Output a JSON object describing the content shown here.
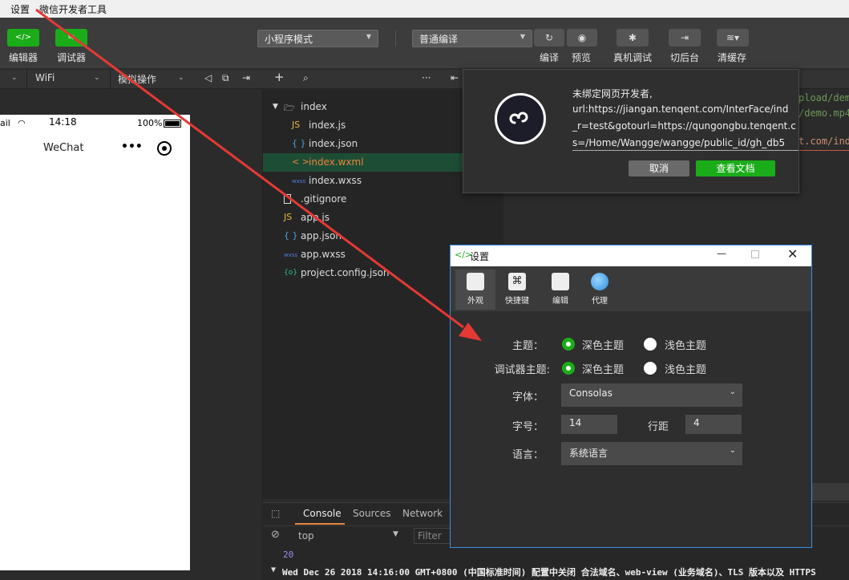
{
  "menubar": {
    "settings": "设置",
    "app_name": "微信开发者工具"
  },
  "toolbar": {
    "editor_label": "编辑器",
    "debugger_label": "调试器",
    "mode_select": "小程序模式",
    "compile_select": "普通编译",
    "compile_label": "编译",
    "preview_label": "预览",
    "device_debug_label": "真机调试",
    "background_label": "切后台",
    "clear_cache_label": "清缓存"
  },
  "subbar": {
    "network": "WiFi",
    "sim_ops": "模拟操作"
  },
  "phone": {
    "carrier": "ail",
    "time": "14:18",
    "battery": "100%",
    "title": "WeChat"
  },
  "filetree": {
    "folder": "index",
    "files": [
      {
        "name": "index.js",
        "icon": "JS",
        "color": "#e8b840"
      },
      {
        "name": "index.json",
        "icon": "{ }",
        "color": "#4aa3df"
      },
      {
        "name": "index.wxml",
        "icon": "< >",
        "color": "#e8843c"
      },
      {
        "name": "index.wxss",
        "icon": "wxss",
        "color": "#4a7fdf"
      },
      {
        "name": ".gitignore",
        "icon": "doc",
        "color": "#ddd"
      },
      {
        "name": "app.js",
        "icon": "JS",
        "color": "#e8b840"
      },
      {
        "name": "app.json",
        "icon": "{ }",
        "color": "#4aa3df"
      },
      {
        "name": "app.wxss",
        "icon": "wxss",
        "color": "#4a7fdf"
      },
      {
        "name": "project.config.json",
        "icon": "{o}",
        "color": "#2bbf8f"
      }
    ]
  },
  "editor": {
    "line1": "pload/dem",
    "line2": "/demo.mp4",
    "line3": "t.com/ind"
  },
  "notification": {
    "line1": "未绑定网页开发者,",
    "line2": "url:https://jiangan.tenqent.com/InterFace/ind",
    "line3": "_r=test&gotourl=https://qungongbu.tenqent.c",
    "line4": "s=/Home/Wangge/wangge/public_id/gh_db5",
    "cancel": "取消",
    "docs": "查看文档"
  },
  "settings": {
    "title": "设置",
    "tabs": [
      "外观",
      "快捷键",
      "编辑",
      "代理"
    ],
    "theme_label": "主题：",
    "debugger_theme_label": "调试器主题:",
    "dark": "深色主题",
    "light": "浅色主题",
    "font_label": "字体：",
    "font_value": "Consolas",
    "size_label": "字号：",
    "size_value": "14",
    "line_height_label": "行距",
    "line_height_value": "4",
    "lang_label": "语言：",
    "lang_value": "系统语言"
  },
  "console": {
    "tabs": [
      "Console",
      "Sources",
      "Network"
    ],
    "context": "top",
    "filter_placeholder": "Filter",
    "value": "20",
    "message": "Wed Dec 26 2018 14:16:00 GMT+0800 (中国标准时间) 配置中关闭 合法域名、web-view (业务域名)、TLS 版本以及 HTTPS"
  }
}
